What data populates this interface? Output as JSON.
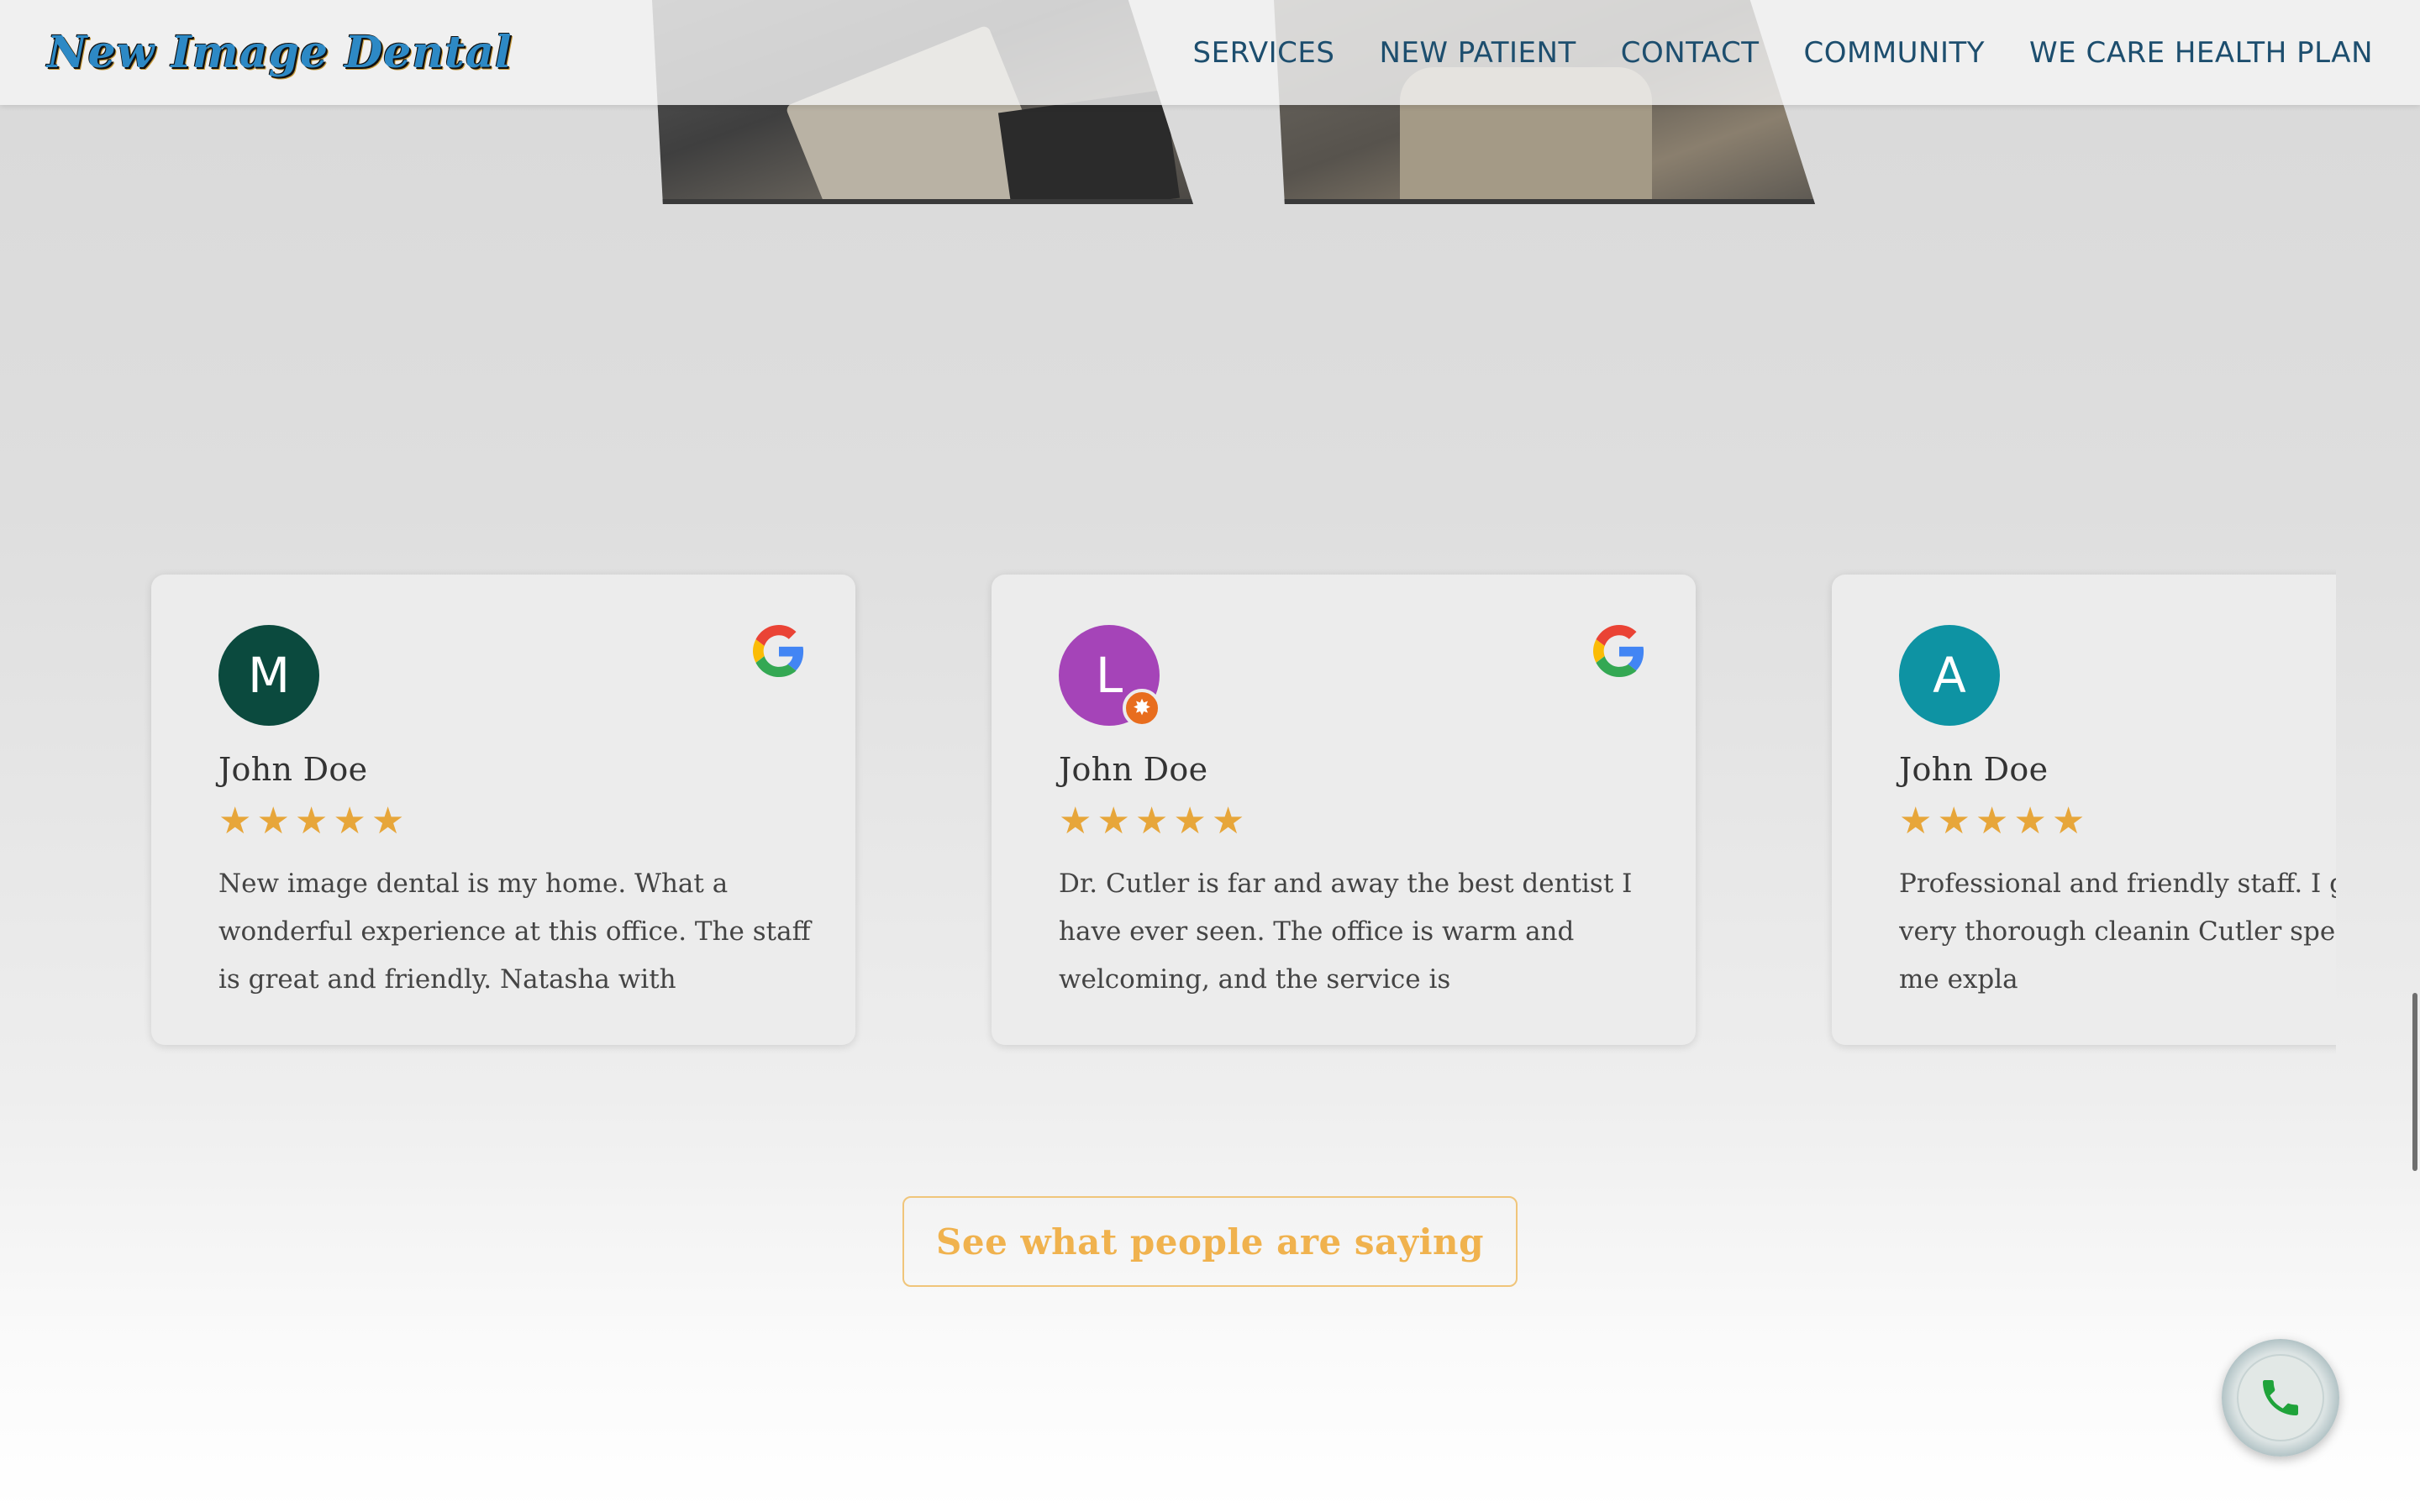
{
  "header": {
    "logo_text": "New Image Dental",
    "nav": [
      {
        "label": "SERVICES"
      },
      {
        "label": "NEW PATIENT"
      },
      {
        "label": "CONTACT"
      },
      {
        "label": "COMMUNITY"
      },
      {
        "label": "WE CARE HEALTH PLAN"
      }
    ]
  },
  "reviews": [
    {
      "initial": "M",
      "avatar_color": "#0b4a3e",
      "name": "John Doe",
      "rating": 5,
      "text": "New image dental is my home. What a wonderful experience at this office. The staff is great and friendly. Natasha with",
      "source_icon": "google-icon"
    },
    {
      "initial": "L",
      "avatar_color": "#a544b8",
      "name": "John Doe",
      "rating": 5,
      "text": "Dr. Cutler is far and away the best dentist I have ever seen. The office is warm and welcoming, and the service is",
      "source_icon": "google-icon",
      "badge": true
    },
    {
      "initial": "A",
      "avatar_color": "#0e93a3",
      "name": "John Doe",
      "rating": 5,
      "text": "Professional and friendly staff. I gave me a very thorough cleanin Cutler spent time with me expla"
    }
  ],
  "cta": {
    "label": "See what people are saying"
  },
  "phone_button": {
    "icon": "phone-icon"
  },
  "colors": {
    "nav": "#1d4e6e",
    "star": "#e7a63a",
    "cta": "#f0b24e",
    "google_blue": "#4285F4",
    "google_red": "#EA4335",
    "google_yellow": "#FBBC05",
    "google_green": "#34A853"
  }
}
